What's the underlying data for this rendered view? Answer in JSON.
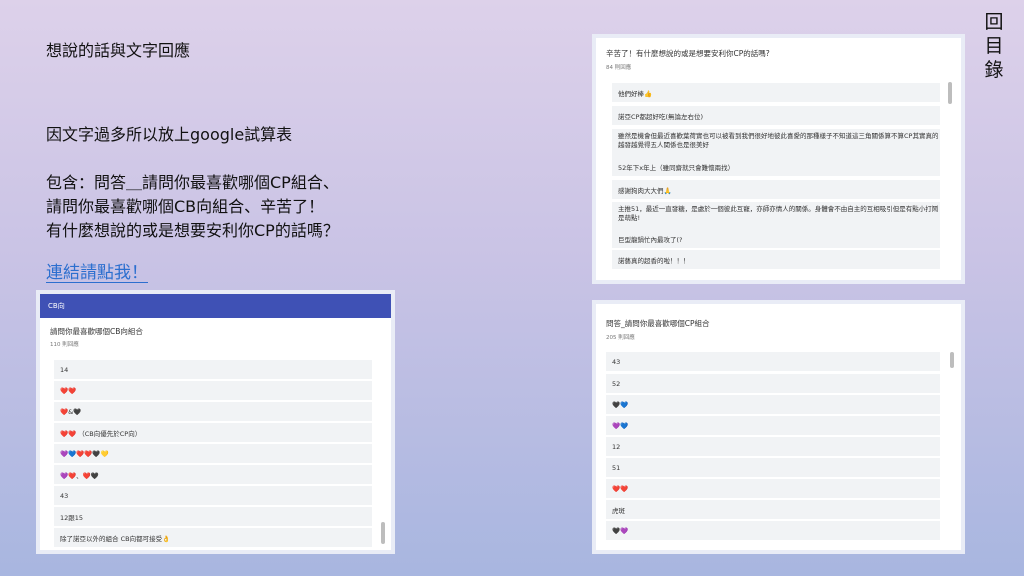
{
  "slide": {
    "title": "想說的話與文字回應",
    "intro": "因文字過多所以放上google試算表",
    "contains_line1": "包含：問答＿請問你最喜歡哪個CP組合、",
    "contains_line2": "請問你最喜歡哪個CB向組合、辛苦了！",
    "contains_line3": "有什麼想說的或是想要安利你CP的話嗎？",
    "link_text": "連結請點我！",
    "toc_chars": [
      "回",
      "目",
      "錄"
    ]
  },
  "shot1": {
    "question": "辛苦了！有什麼想說的或是想要安利你CP的話嗎?",
    "count": "84 則回應",
    "responses": [
      "他們好棒👍",
      "諾亞CP都超好吃(無論左右位)",
      "雖然是機會但最近喜歡葉荷實也可以被看到我們很好地彼此喜愛的那種樣子不知道這三角關係算不算CP其實真的越發越覺得五人関係也是很美好",
      "52年下x年上（雖同齋就只會難懷兩找）",
      "感謝狗肉大大們🙏",
      "主推51，最近一直發糖，是處於一個彼此互寵，亦師亦情人的關係。身體會不由自主的互相吸引但是有點小打鬧是萌點!",
      "巨型龍鍋忙內最攻了(?",
      "諾藝真的超香的啦！！！"
    ]
  },
  "shot2": {
    "header": "CB向",
    "question": "請問你最喜歡哪個CB向組合",
    "count": "110 則回應",
    "responses": [
      "14",
      "❤️❤️",
      "❤️&🖤",
      "❤️❤️ （CB向優先於CP向）",
      "💜💙❤️❤️🖤💛",
      "💜❤️、❤️🖤",
      "43",
      "12跟15",
      "除了諾亞以外的組合 CB向都可接受👌"
    ]
  },
  "shot3": {
    "question": "問答_請問你最喜歡哪個CP組合",
    "count": "205 則回應",
    "responses": [
      "43",
      "52",
      "🖤💙",
      "💜💙",
      "12",
      "51",
      "❤️❤️",
      "虎斑",
      "🖤💜"
    ]
  },
  "colors": {
    "link": "#2c6fcf",
    "form_header": "#3f51b5"
  }
}
